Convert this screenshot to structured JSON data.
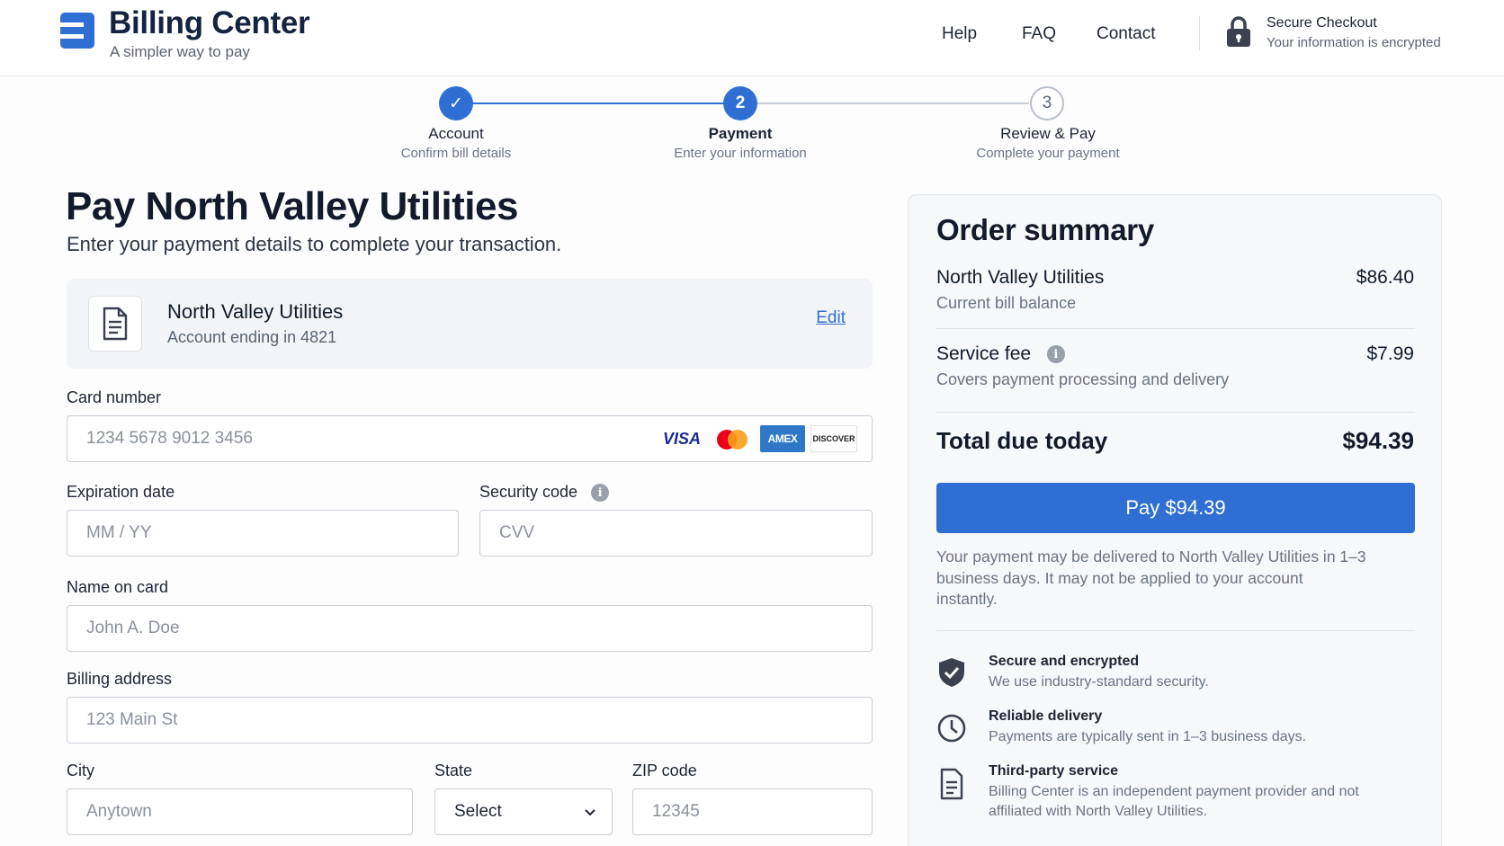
{
  "header": {
    "brand_title": "Billing Center",
    "brand_subtitle": "A simpler way to pay",
    "nav": [
      "Help",
      "FAQ",
      "Contact"
    ],
    "secure_title": "Secure Checkout",
    "secure_subtitle": "Your information is encrypted"
  },
  "stepper": {
    "current_step": 2,
    "steps": [
      {
        "label": "Account",
        "sub": "Confirm bill details",
        "status": "complete",
        "marker": "✓"
      },
      {
        "label": "Payment",
        "sub": "Enter your information",
        "status": "active",
        "marker": "2"
      },
      {
        "label": "Review & Pay",
        "sub": "Complete your payment",
        "status": "upcoming",
        "marker": "3"
      }
    ]
  },
  "main": {
    "title": "Pay North Valley Utilities",
    "subtitle": "Enter your payment details to complete your transaction.",
    "account": {
      "name": "North Valley Utilities",
      "detail": "Account ending in 4821",
      "edit_label": "Edit"
    },
    "form": {
      "card_number": {
        "label": "Card number",
        "placeholder": "1234 5678 9012 3456",
        "value": ""
      },
      "card_brands": {
        "visa": "VISA",
        "amex": "AMEX",
        "discover": "DISCOVER"
      },
      "expiration": {
        "label": "Expiration date",
        "placeholder": "MM / YY",
        "value": ""
      },
      "security_code": {
        "label": "Security code",
        "placeholder": "CVV",
        "value": ""
      },
      "name_on_card": {
        "label": "Name on card",
        "placeholder": "John A. Doe",
        "value": ""
      },
      "billing_address": {
        "label": "Billing address",
        "placeholder": "123 Main St",
        "value": ""
      },
      "city": {
        "label": "City",
        "placeholder": "Anytown",
        "value": ""
      },
      "state": {
        "label": "State",
        "selected": "Select"
      },
      "zip": {
        "label": "ZIP code",
        "placeholder": "12345",
        "value": ""
      }
    }
  },
  "summary": {
    "title": "Order summary",
    "items": [
      {
        "name": "North Valley Utilities",
        "sub": "Current bill balance",
        "amount": "$86.40"
      },
      {
        "name": "Service fee",
        "sub": "Covers payment processing and delivery",
        "amount": "$7.99"
      }
    ],
    "total_label": "Total due today",
    "total_amount": "$94.39",
    "pay_button": "Pay $94.39",
    "note": "Your payment may be delivered to North Valley Utilities in 1–3 business days. It may not be applied to your account instantly.",
    "features": [
      {
        "icon": "shield-check-icon",
        "title": "Secure and encrypted",
        "sub": "We use industry-standard security."
      },
      {
        "icon": "clock-icon",
        "title": "Reliable delivery",
        "sub": "Payments are typically sent in 1–3 business days."
      },
      {
        "icon": "document-icon",
        "title": "Third-party service",
        "sub": "Billing Center is an independent payment provider and not affiliated with North Valley Utilities."
      }
    ]
  },
  "colors": {
    "accent": "#2f6fd4",
    "brand_navy": "#14233f",
    "muted_text": "#6b7383",
    "card_background": "#f2f4f7"
  }
}
